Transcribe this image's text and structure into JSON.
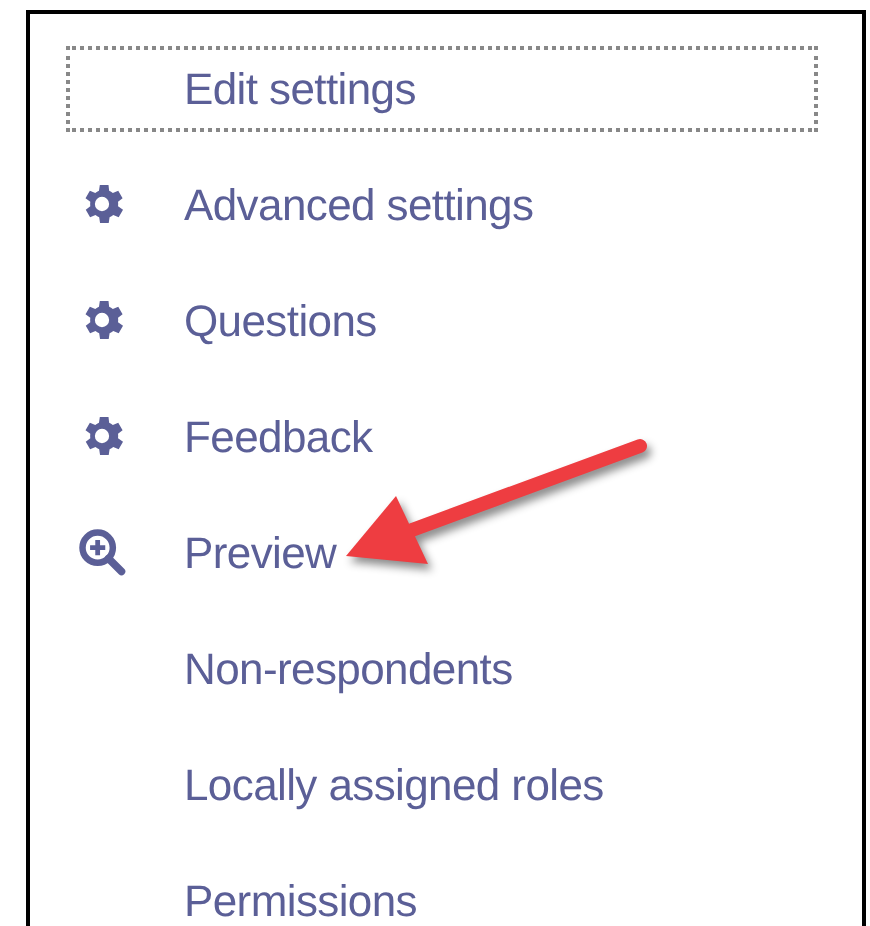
{
  "menu": [
    {
      "label": "Edit settings",
      "kind": "plain",
      "focused": true,
      "pointed_at": false
    },
    {
      "label": "Advanced settings",
      "kind": "gear",
      "focused": false,
      "pointed_at": false
    },
    {
      "label": "Questions",
      "kind": "gear",
      "focused": false,
      "pointed_at": false
    },
    {
      "label": "Feedback",
      "kind": "gear",
      "focused": false,
      "pointed_at": false
    },
    {
      "label": "Preview",
      "kind": "zoom",
      "focused": false,
      "pointed_at": true
    },
    {
      "label": "Non-respondents",
      "kind": "plain",
      "focused": false,
      "pointed_at": false
    },
    {
      "label": "Locally assigned roles",
      "kind": "plain",
      "focused": false,
      "pointed_at": false
    },
    {
      "label": "Permissions",
      "kind": "plain",
      "focused": false,
      "pointed_at": false
    }
  ]
}
